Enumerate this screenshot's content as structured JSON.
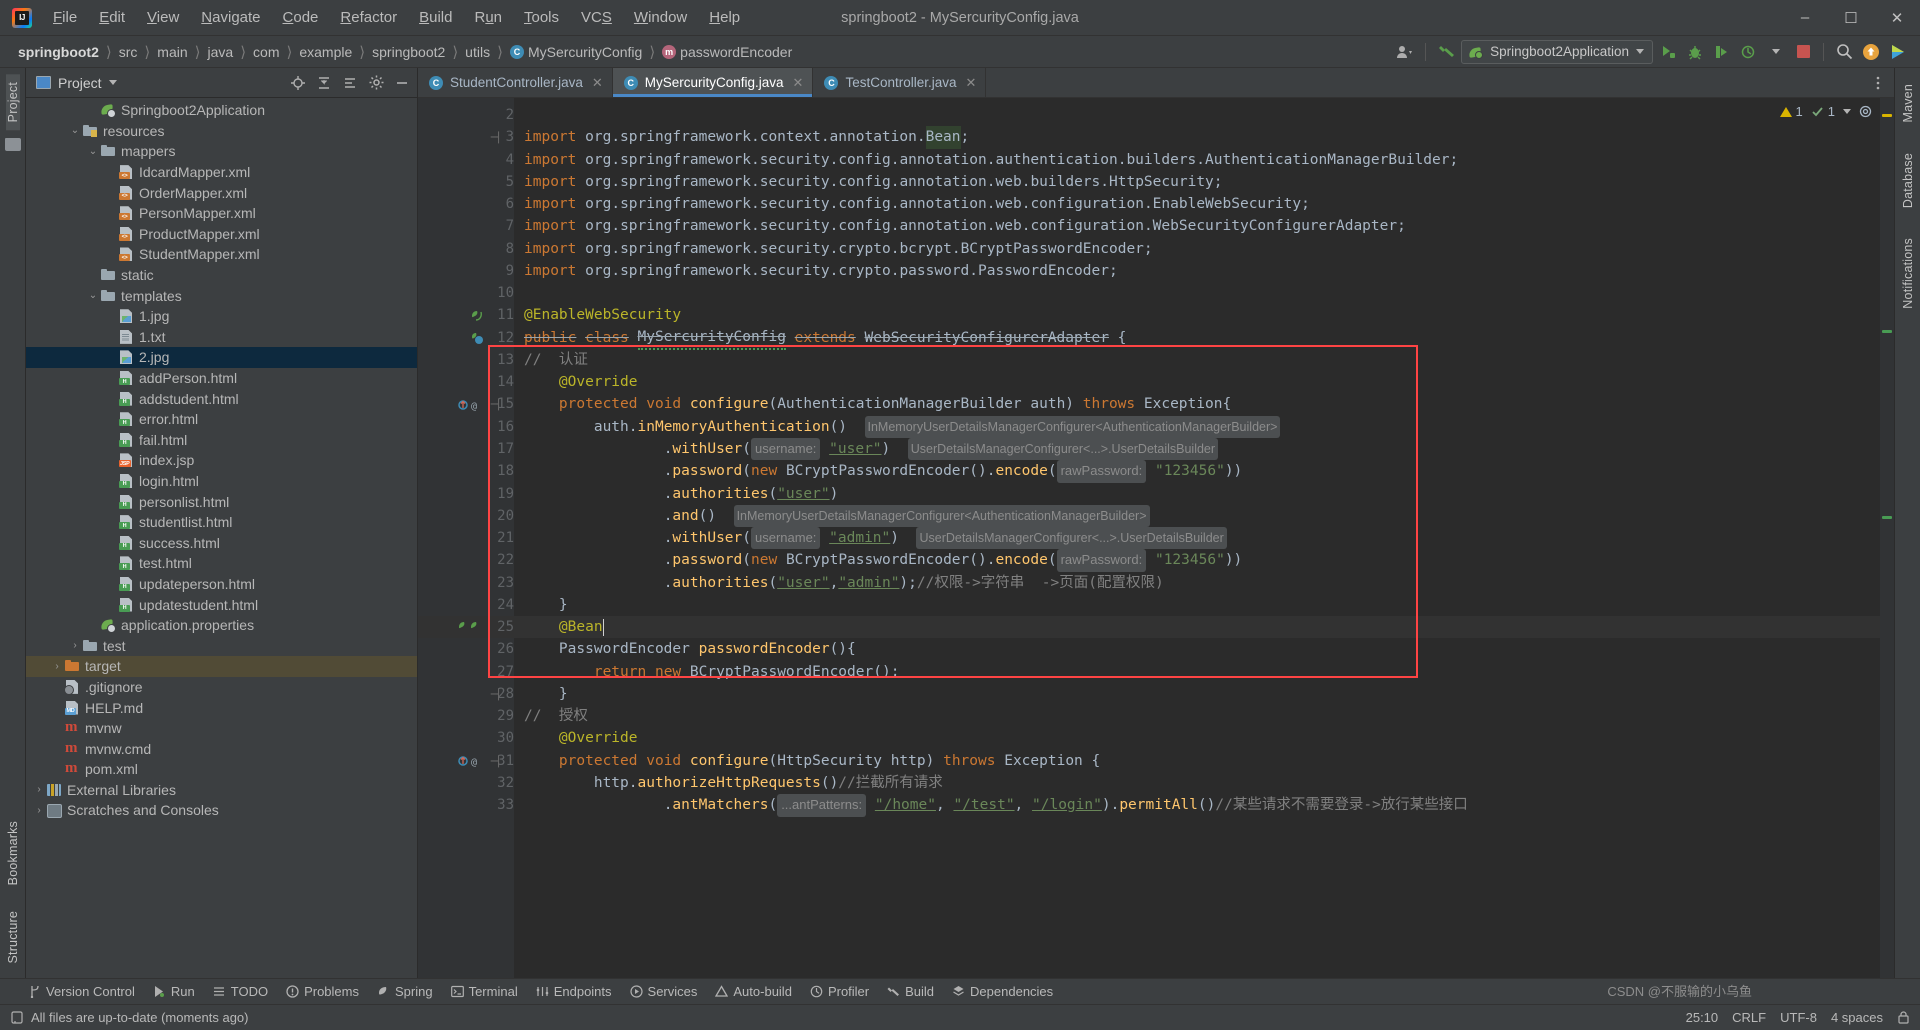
{
  "titlebar": {
    "logo": "intellij-idea-logo",
    "window_title": "springboot2 - MySercurityConfig.java",
    "menus": [
      "File",
      "Edit",
      "View",
      "Navigate",
      "Code",
      "Refactor",
      "Build",
      "Run",
      "Tools",
      "VCS",
      "Window",
      "Help"
    ],
    "minimize": "–",
    "maximize": "❐",
    "close": "✕"
  },
  "navbar": {
    "crumbs": [
      {
        "label": "springboot2",
        "icon": "",
        "bold": true
      },
      {
        "label": "src",
        "icon": ""
      },
      {
        "label": "main",
        "icon": ""
      },
      {
        "label": "java",
        "icon": ""
      },
      {
        "label": "com",
        "icon": ""
      },
      {
        "label": "example",
        "icon": ""
      },
      {
        "label": "springboot2",
        "icon": ""
      },
      {
        "label": "utils",
        "icon": ""
      },
      {
        "label": "MySercurityConfig",
        "icon": "class-icon",
        "badge": "C"
      },
      {
        "label": "passwordEncoder",
        "icon": "method-icon",
        "badge": "m"
      }
    ],
    "separator": "〉",
    "run_config": "Springboot2Application",
    "icons": [
      "user-avatar-icon",
      "hammer-build-icon",
      "run-icon",
      "debug-icon",
      "run-with-coverage-icon",
      "profiler-icon",
      "stop-icon",
      "search-icon",
      "update-icon",
      "ide-feature-icon"
    ]
  },
  "project_panel": {
    "title": "Project",
    "tools": [
      "locate-icon",
      "collapse-all-icon",
      "expand-icon",
      "settings-gear-icon",
      "hide-icon"
    ],
    "tree": [
      {
        "label": "Springboot2Application",
        "icon": "spring-boot-icon",
        "indent": 4,
        "twist": ""
      },
      {
        "label": "resources",
        "icon": "resources-folder-icon",
        "indent": 3,
        "twist": "⌄"
      },
      {
        "label": "mappers",
        "icon": "folder-icon",
        "indent": 4,
        "twist": "⌄"
      },
      {
        "label": "IdcardMapper.xml",
        "icon": "xml-file-icon",
        "indent": 5,
        "twist": ""
      },
      {
        "label": "OrderMapper.xml",
        "icon": "xml-file-icon",
        "indent": 5,
        "twist": ""
      },
      {
        "label": "PersonMapper.xml",
        "icon": "xml-file-icon",
        "indent": 5,
        "twist": ""
      },
      {
        "label": "ProductMapper.xml",
        "icon": "xml-file-icon",
        "indent": 5,
        "twist": ""
      },
      {
        "label": "StudentMapper.xml",
        "icon": "xml-file-icon",
        "indent": 5,
        "twist": ""
      },
      {
        "label": "static",
        "icon": "folder-icon",
        "indent": 4,
        "twist": ""
      },
      {
        "label": "templates",
        "icon": "folder-icon",
        "indent": 4,
        "twist": "⌄"
      },
      {
        "label": "1.jpg",
        "icon": "image-file-icon",
        "indent": 5,
        "twist": ""
      },
      {
        "label": "1.txt",
        "icon": "text-file-icon",
        "indent": 5,
        "twist": ""
      },
      {
        "label": "2.jpg",
        "icon": "image-file-icon",
        "indent": 5,
        "twist": "",
        "selected": true
      },
      {
        "label": "addPerson.html",
        "icon": "html-file-icon",
        "indent": 5,
        "twist": ""
      },
      {
        "label": "addstudent.html",
        "icon": "html-file-icon",
        "indent": 5,
        "twist": ""
      },
      {
        "label": "error.html",
        "icon": "html-file-icon",
        "indent": 5,
        "twist": ""
      },
      {
        "label": "fail.html",
        "icon": "html-file-icon",
        "indent": 5,
        "twist": ""
      },
      {
        "label": "index.jsp",
        "icon": "jsp-file-icon",
        "indent": 5,
        "twist": ""
      },
      {
        "label": "login.html",
        "icon": "html-file-icon",
        "indent": 5,
        "twist": ""
      },
      {
        "label": "personlist.html",
        "icon": "html-file-icon",
        "indent": 5,
        "twist": ""
      },
      {
        "label": "studentlist.html",
        "icon": "html-file-icon",
        "indent": 5,
        "twist": ""
      },
      {
        "label": "success.html",
        "icon": "html-file-icon",
        "indent": 5,
        "twist": ""
      },
      {
        "label": "test.html",
        "icon": "html-file-icon",
        "indent": 5,
        "twist": ""
      },
      {
        "label": "updateperson.html",
        "icon": "html-file-icon",
        "indent": 5,
        "twist": ""
      },
      {
        "label": "updatestudent.html",
        "icon": "html-file-icon",
        "indent": 5,
        "twist": ""
      },
      {
        "label": "application.properties",
        "icon": "spring-properties-icon",
        "indent": 4,
        "twist": ""
      },
      {
        "label": "test",
        "icon": "folder-icon",
        "indent": 3,
        "twist": "›"
      },
      {
        "label": "target",
        "icon": "folder-orange-icon",
        "indent": 2,
        "twist": "›",
        "hover": true
      },
      {
        "label": ".gitignore",
        "icon": "gitignore-file-icon",
        "indent": 2,
        "twist": ""
      },
      {
        "label": "HELP.md",
        "icon": "markdown-file-icon",
        "indent": 2,
        "twist": ""
      },
      {
        "label": "mvnw",
        "icon": "maven-wrapper-icon",
        "indent": 2,
        "twist": ""
      },
      {
        "label": "mvnw.cmd",
        "icon": "maven-cmd-icon",
        "indent": 2,
        "twist": ""
      },
      {
        "label": "pom.xml",
        "icon": "maven-pom-icon",
        "indent": 2,
        "twist": ""
      },
      {
        "label": "External Libraries",
        "icon": "library-icon",
        "indent": 1,
        "twist": "›"
      },
      {
        "label": "Scratches and Consoles",
        "icon": "scratch-icon",
        "indent": 1,
        "twist": "›"
      }
    ]
  },
  "left_strip": {
    "labels": [
      "Project",
      "Bookmarks",
      "Structure"
    ]
  },
  "right_strip": {
    "labels": [
      "Maven",
      "Database",
      "Notifications"
    ]
  },
  "editor": {
    "tabs": [
      {
        "label": "StudentController.java",
        "badge": "C",
        "active": false
      },
      {
        "label": "MySercurityConfig.java",
        "badge": "C",
        "active": true
      },
      {
        "label": "TestController.java",
        "badge": "C",
        "active": false
      }
    ],
    "inspection": {
      "warnings": "1",
      "weak_warnings": "1"
    },
    "first_line_number": 2,
    "lines": [
      {
        "n": 2,
        "text": ""
      },
      {
        "n": 3,
        "text": "import org.springframework.context.annotation.Bean;"
      },
      {
        "n": 4,
        "text": "import org.springframework.security.config.annotation.authentication.builders.AuthenticationManagerBuilder;"
      },
      {
        "n": 5,
        "text": "import org.springframework.security.config.annotation.web.builders.HttpSecurity;"
      },
      {
        "n": 6,
        "text": "import org.springframework.security.config.annotation.web.configuration.EnableWebSecurity;"
      },
      {
        "n": 7,
        "text": "import org.springframework.security.config.annotation.web.configuration.WebSecurityConfigurerAdapter;"
      },
      {
        "n": 8,
        "text": "import org.springframework.security.crypto.bcrypt.BCryptPasswordEncoder;"
      },
      {
        "n": 9,
        "text": "import org.springframework.security.crypto.password.PasswordEncoder;"
      },
      {
        "n": 10,
        "text": ""
      },
      {
        "n": 11,
        "text": "@EnableWebSecurity"
      },
      {
        "n": 12,
        "text": "public class MySercurityConfig extends WebSecurityConfigurerAdapter {"
      },
      {
        "n": 13,
        "text": "//  认证"
      },
      {
        "n": 14,
        "text": "    @Override"
      },
      {
        "n": 15,
        "text": "    protected void configure(AuthenticationManagerBuilder auth) throws Exception{"
      },
      {
        "n": 16,
        "text": "        auth.inMemoryAuthentication()  InMemoryUserDetailsManagerConfigurer<AuthenticationManagerBuilder>"
      },
      {
        "n": 17,
        "text": "                .withUser( username: \"user\")  UserDetailsManagerConfigurer<...>.UserDetailsBuilder"
      },
      {
        "n": 18,
        "text": "                .password(new BCryptPasswordEncoder().encode( rawPassword: \"123456\"))"
      },
      {
        "n": 19,
        "text": "                .authorities(\"user\")"
      },
      {
        "n": 20,
        "text": "                .and()  InMemoryUserDetailsManagerConfigurer<AuthenticationManagerBuilder>"
      },
      {
        "n": 21,
        "text": "                .withUser( username: \"admin\")  UserDetailsManagerConfigurer<...>.UserDetailsBuilder"
      },
      {
        "n": 22,
        "text": "                .password(new BCryptPasswordEncoder().encode( rawPassword: \"123456\"))"
      },
      {
        "n": 23,
        "text": "                .authorities(\"user\",\"admin\");//权限->字符串  ->页面(配置权限)"
      },
      {
        "n": 24,
        "text": "    }"
      },
      {
        "n": 25,
        "text": "    @Bean"
      },
      {
        "n": 26,
        "text": "    PasswordEncoder passwordEncoder(){"
      },
      {
        "n": 27,
        "text": "        return new BCryptPasswordEncoder();"
      },
      {
        "n": 28,
        "text": "    }"
      },
      {
        "n": 29,
        "text": "//  授权"
      },
      {
        "n": 30,
        "text": "    @Override"
      },
      {
        "n": 31,
        "text": "    protected void configure(HttpSecurity http) throws Exception {"
      },
      {
        "n": 32,
        "text": "        http.authorizeHttpRequests()//拦截所有请求"
      },
      {
        "n": 33,
        "text": "                .antMatchers( ...antPatterns: \"/home\", \"/test\", \"/login\").permitAll()//某些请求不需要登录->放行某些接口"
      }
    ],
    "annotation": {
      "type": "red-rectangle",
      "color": "#ff4444"
    }
  },
  "tool_windows": [
    {
      "label": "Version Control",
      "icon": "branch-icon"
    },
    {
      "label": "Run",
      "icon": "run-icon"
    },
    {
      "label": "TODO",
      "icon": "todo-list-icon"
    },
    {
      "label": "Problems",
      "icon": "problems-icon"
    },
    {
      "label": "Spring",
      "icon": "spring-leaf-icon"
    },
    {
      "label": "Terminal",
      "icon": "terminal-icon"
    },
    {
      "label": "Endpoints",
      "icon": "endpoints-icon"
    },
    {
      "label": "Services",
      "icon": "services-icon"
    },
    {
      "label": "Auto-build",
      "icon": "auto-build-icon"
    },
    {
      "label": "Profiler",
      "icon": "profiler-icon"
    },
    {
      "label": "Build",
      "icon": "hammer-icon"
    },
    {
      "label": "Dependencies",
      "icon": "dependencies-icon"
    }
  ],
  "statusbar": {
    "message": "All files are up-to-date (moments ago)",
    "caret": "25:10",
    "line_sep": "CRLF",
    "encoding": "UTF-8",
    "indent": "4 spaces",
    "lock": "lock-icon",
    "watermark": "CSDN @不服输的小乌鱼"
  }
}
